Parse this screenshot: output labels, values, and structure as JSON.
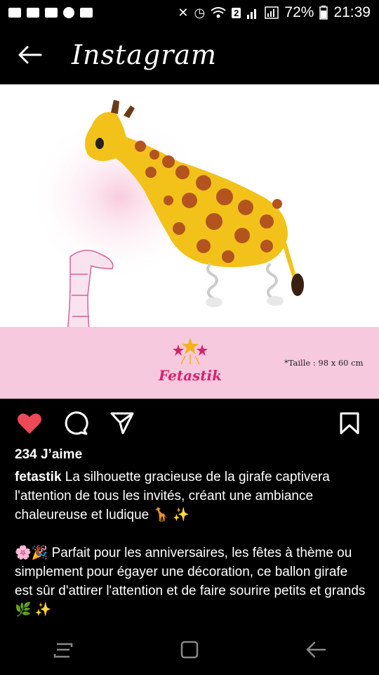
{
  "status": {
    "battery": "72%",
    "time": "21:39",
    "sim_badge": "2",
    "left_icons": [
      "message-icon",
      "message-icon",
      "message-icon",
      "whatsapp-icon",
      "gallery-icon"
    ],
    "right_icons": [
      "mute-icon",
      "alarm-icon",
      "wifi-icon",
      "signal-icon",
      "signal-icon",
      "battery-icon"
    ]
  },
  "header": {
    "title": "Instagram",
    "back_icon": "back-arrow-icon"
  },
  "post": {
    "image": {
      "brand": "Fetastik",
      "size_note": "*Taille : 98 x 60 cm",
      "colors": {
        "band": "#f6c9de",
        "brand": "#d4236f",
        "giraffe": "#f2c21a",
        "spots": "#b3541e"
      }
    },
    "actions": {
      "like_icon": "heart-icon",
      "comment_icon": "comment-icon",
      "share_icon": "send-icon",
      "save_icon": "bookmark-icon",
      "like_color": "#ed4956"
    },
    "likes": "234 J’aime",
    "username": "fetastik",
    "caption_line1": " La silhouette gracieuse de la girafe captivera l'attention de tous les invités, créant une ambiance chaleureuse et ludique 🦒 ✨",
    "caption_line2": "🌸🎉 Parfait pour les anniversaires, les fêtes à thème ou simplement pour égayer une décoration, ce ballon girafe est sûr d'attirer l'attention et de faire sourire petits et grands🌿 ✨"
  },
  "nav": {
    "icons": [
      "recent-apps-icon",
      "home-icon",
      "back-icon"
    ]
  }
}
